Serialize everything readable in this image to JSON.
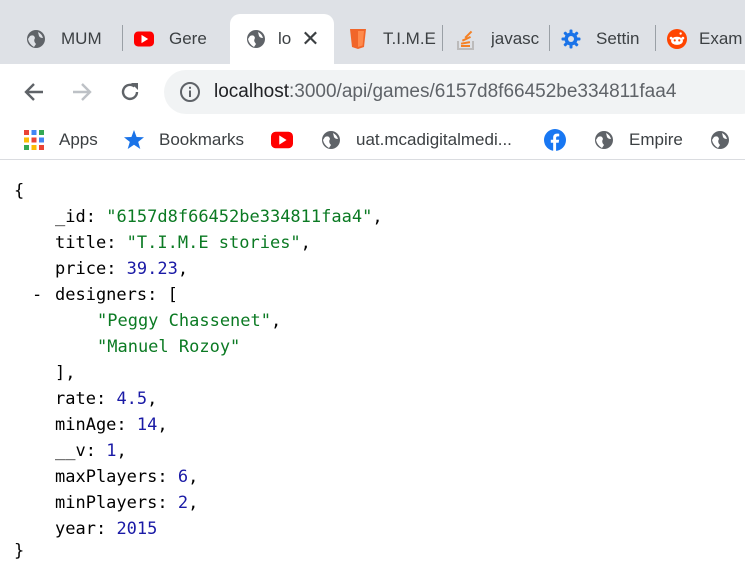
{
  "tabs": [
    {
      "label": "MUM",
      "icon": "globe-icon"
    },
    {
      "label": "Gere",
      "icon": "youtube-icon"
    },
    {
      "label": "lo",
      "icon": "globe-icon",
      "active": true
    },
    {
      "label": "T.I.M.E",
      "icon": "html5-icon"
    },
    {
      "label": "javasc",
      "icon": "stackoverflow-icon"
    },
    {
      "label": "Settin",
      "icon": "gear-icon"
    },
    {
      "label": "Exam",
      "icon": "reddit-icon"
    }
  ],
  "toolbar": {
    "url_host": "localhost",
    "url_path": ":3000/api/games/6157d8f66452be334811faa4"
  },
  "bookmarks": [
    {
      "label": "Apps",
      "icon": "apps-grid-icon"
    },
    {
      "label": "Bookmarks",
      "icon": "star-icon"
    },
    {
      "label": "",
      "icon": "youtube-icon"
    },
    {
      "label": "uat.mcadigitalmedi...",
      "icon": "globe-icon"
    },
    {
      "label": "",
      "icon": "facebook-icon"
    },
    {
      "label": "Empire",
      "icon": "globe-icon"
    },
    {
      "label": "",
      "icon": "globe-icon"
    }
  ],
  "json": {
    "open_brace": "{",
    "close_brace": "}",
    "id_key": "_id",
    "id_value": "\"6157d8f66452be334811faa4\"",
    "title_key": "title",
    "title_value": "\"T.I.M.E stories\"",
    "price_key": "price",
    "price_value": "39.23",
    "collapse_toggle": "-",
    "designers_key": "designers",
    "designers_open": "[",
    "designer_1": "\"Peggy Chassenet\"",
    "designer_2": "\"Manuel Rozoy\"",
    "designers_close": "],",
    "rate_key": "rate",
    "rate_value": "4.5",
    "minage_key": "minAge",
    "minage_value": "14",
    "v_key": "__v",
    "v_value": "1",
    "maxplayers_key": "maxPlayers",
    "maxplayers_value": "6",
    "minplayers_key": "minPlayers",
    "minplayers_value": "2",
    "year_key": "year",
    "year_value": "2015"
  }
}
